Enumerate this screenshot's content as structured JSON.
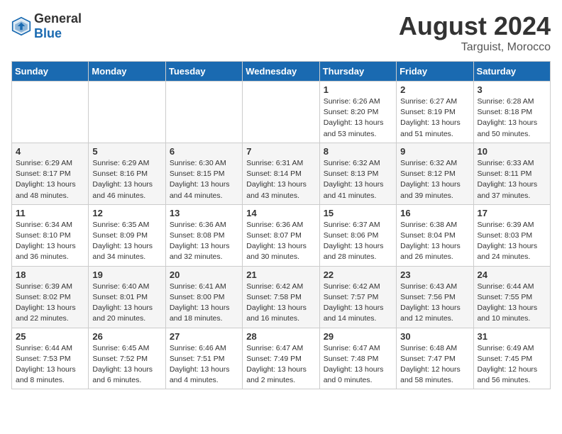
{
  "logo": {
    "general": "General",
    "blue": "Blue"
  },
  "title": {
    "month_year": "August 2024",
    "location": "Targuist, Morocco"
  },
  "days_of_week": [
    "Sunday",
    "Monday",
    "Tuesday",
    "Wednesday",
    "Thursday",
    "Friday",
    "Saturday"
  ],
  "weeks": [
    [
      {
        "day": "",
        "info": ""
      },
      {
        "day": "",
        "info": ""
      },
      {
        "day": "",
        "info": ""
      },
      {
        "day": "",
        "info": ""
      },
      {
        "day": "1",
        "info": "Sunrise: 6:26 AM\nSunset: 8:20 PM\nDaylight: 13 hours\nand 53 minutes."
      },
      {
        "day": "2",
        "info": "Sunrise: 6:27 AM\nSunset: 8:19 PM\nDaylight: 13 hours\nand 51 minutes."
      },
      {
        "day": "3",
        "info": "Sunrise: 6:28 AM\nSunset: 8:18 PM\nDaylight: 13 hours\nand 50 minutes."
      }
    ],
    [
      {
        "day": "4",
        "info": "Sunrise: 6:29 AM\nSunset: 8:17 PM\nDaylight: 13 hours\nand 48 minutes."
      },
      {
        "day": "5",
        "info": "Sunrise: 6:29 AM\nSunset: 8:16 PM\nDaylight: 13 hours\nand 46 minutes."
      },
      {
        "day": "6",
        "info": "Sunrise: 6:30 AM\nSunset: 8:15 PM\nDaylight: 13 hours\nand 44 minutes."
      },
      {
        "day": "7",
        "info": "Sunrise: 6:31 AM\nSunset: 8:14 PM\nDaylight: 13 hours\nand 43 minutes."
      },
      {
        "day": "8",
        "info": "Sunrise: 6:32 AM\nSunset: 8:13 PM\nDaylight: 13 hours\nand 41 minutes."
      },
      {
        "day": "9",
        "info": "Sunrise: 6:32 AM\nSunset: 8:12 PM\nDaylight: 13 hours\nand 39 minutes."
      },
      {
        "day": "10",
        "info": "Sunrise: 6:33 AM\nSunset: 8:11 PM\nDaylight: 13 hours\nand 37 minutes."
      }
    ],
    [
      {
        "day": "11",
        "info": "Sunrise: 6:34 AM\nSunset: 8:10 PM\nDaylight: 13 hours\nand 36 minutes."
      },
      {
        "day": "12",
        "info": "Sunrise: 6:35 AM\nSunset: 8:09 PM\nDaylight: 13 hours\nand 34 minutes."
      },
      {
        "day": "13",
        "info": "Sunrise: 6:36 AM\nSunset: 8:08 PM\nDaylight: 13 hours\nand 32 minutes."
      },
      {
        "day": "14",
        "info": "Sunrise: 6:36 AM\nSunset: 8:07 PM\nDaylight: 13 hours\nand 30 minutes."
      },
      {
        "day": "15",
        "info": "Sunrise: 6:37 AM\nSunset: 8:06 PM\nDaylight: 13 hours\nand 28 minutes."
      },
      {
        "day": "16",
        "info": "Sunrise: 6:38 AM\nSunset: 8:04 PM\nDaylight: 13 hours\nand 26 minutes."
      },
      {
        "day": "17",
        "info": "Sunrise: 6:39 AM\nSunset: 8:03 PM\nDaylight: 13 hours\nand 24 minutes."
      }
    ],
    [
      {
        "day": "18",
        "info": "Sunrise: 6:39 AM\nSunset: 8:02 PM\nDaylight: 13 hours\nand 22 minutes."
      },
      {
        "day": "19",
        "info": "Sunrise: 6:40 AM\nSunset: 8:01 PM\nDaylight: 13 hours\nand 20 minutes."
      },
      {
        "day": "20",
        "info": "Sunrise: 6:41 AM\nSunset: 8:00 PM\nDaylight: 13 hours\nand 18 minutes."
      },
      {
        "day": "21",
        "info": "Sunrise: 6:42 AM\nSunset: 7:58 PM\nDaylight: 13 hours\nand 16 minutes."
      },
      {
        "day": "22",
        "info": "Sunrise: 6:42 AM\nSunset: 7:57 PM\nDaylight: 13 hours\nand 14 minutes."
      },
      {
        "day": "23",
        "info": "Sunrise: 6:43 AM\nSunset: 7:56 PM\nDaylight: 13 hours\nand 12 minutes."
      },
      {
        "day": "24",
        "info": "Sunrise: 6:44 AM\nSunset: 7:55 PM\nDaylight: 13 hours\nand 10 minutes."
      }
    ],
    [
      {
        "day": "25",
        "info": "Sunrise: 6:44 AM\nSunset: 7:53 PM\nDaylight: 13 hours\nand 8 minutes."
      },
      {
        "day": "26",
        "info": "Sunrise: 6:45 AM\nSunset: 7:52 PM\nDaylight: 13 hours\nand 6 minutes."
      },
      {
        "day": "27",
        "info": "Sunrise: 6:46 AM\nSunset: 7:51 PM\nDaylight: 13 hours\nand 4 minutes."
      },
      {
        "day": "28",
        "info": "Sunrise: 6:47 AM\nSunset: 7:49 PM\nDaylight: 13 hours\nand 2 minutes."
      },
      {
        "day": "29",
        "info": "Sunrise: 6:47 AM\nSunset: 7:48 PM\nDaylight: 13 hours\nand 0 minutes."
      },
      {
        "day": "30",
        "info": "Sunrise: 6:48 AM\nSunset: 7:47 PM\nDaylight: 12 hours\nand 58 minutes."
      },
      {
        "day": "31",
        "info": "Sunrise: 6:49 AM\nSunset: 7:45 PM\nDaylight: 12 hours\nand 56 minutes."
      }
    ]
  ]
}
